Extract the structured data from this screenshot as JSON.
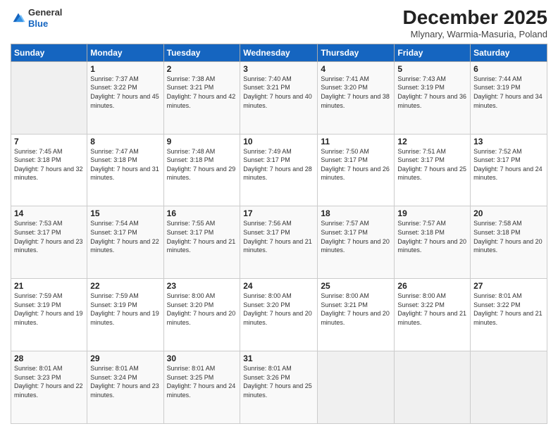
{
  "logo": {
    "general": "General",
    "blue": "Blue"
  },
  "header": {
    "month_title": "December 2025",
    "subtitle": "Mlynary, Warmia-Masuria, Poland"
  },
  "days_of_week": [
    "Sunday",
    "Monday",
    "Tuesday",
    "Wednesday",
    "Thursday",
    "Friday",
    "Saturday"
  ],
  "weeks": [
    [
      {
        "day": "",
        "sunrise": "",
        "sunset": "",
        "daylight": ""
      },
      {
        "day": "1",
        "sunrise": "Sunrise: 7:37 AM",
        "sunset": "Sunset: 3:22 PM",
        "daylight": "Daylight: 7 hours and 45 minutes."
      },
      {
        "day": "2",
        "sunrise": "Sunrise: 7:38 AM",
        "sunset": "Sunset: 3:21 PM",
        "daylight": "Daylight: 7 hours and 42 minutes."
      },
      {
        "day": "3",
        "sunrise": "Sunrise: 7:40 AM",
        "sunset": "Sunset: 3:21 PM",
        "daylight": "Daylight: 7 hours and 40 minutes."
      },
      {
        "day": "4",
        "sunrise": "Sunrise: 7:41 AM",
        "sunset": "Sunset: 3:20 PM",
        "daylight": "Daylight: 7 hours and 38 minutes."
      },
      {
        "day": "5",
        "sunrise": "Sunrise: 7:43 AM",
        "sunset": "Sunset: 3:19 PM",
        "daylight": "Daylight: 7 hours and 36 minutes."
      },
      {
        "day": "6",
        "sunrise": "Sunrise: 7:44 AM",
        "sunset": "Sunset: 3:19 PM",
        "daylight": "Daylight: 7 hours and 34 minutes."
      }
    ],
    [
      {
        "day": "7",
        "sunrise": "Sunrise: 7:45 AM",
        "sunset": "Sunset: 3:18 PM",
        "daylight": "Daylight: 7 hours and 32 minutes."
      },
      {
        "day": "8",
        "sunrise": "Sunrise: 7:47 AM",
        "sunset": "Sunset: 3:18 PM",
        "daylight": "Daylight: 7 hours and 31 minutes."
      },
      {
        "day": "9",
        "sunrise": "Sunrise: 7:48 AM",
        "sunset": "Sunset: 3:18 PM",
        "daylight": "Daylight: 7 hours and 29 minutes."
      },
      {
        "day": "10",
        "sunrise": "Sunrise: 7:49 AM",
        "sunset": "Sunset: 3:17 PM",
        "daylight": "Daylight: 7 hours and 28 minutes."
      },
      {
        "day": "11",
        "sunrise": "Sunrise: 7:50 AM",
        "sunset": "Sunset: 3:17 PM",
        "daylight": "Daylight: 7 hours and 26 minutes."
      },
      {
        "day": "12",
        "sunrise": "Sunrise: 7:51 AM",
        "sunset": "Sunset: 3:17 PM",
        "daylight": "Daylight: 7 hours and 25 minutes."
      },
      {
        "day": "13",
        "sunrise": "Sunrise: 7:52 AM",
        "sunset": "Sunset: 3:17 PM",
        "daylight": "Daylight: 7 hours and 24 minutes."
      }
    ],
    [
      {
        "day": "14",
        "sunrise": "Sunrise: 7:53 AM",
        "sunset": "Sunset: 3:17 PM",
        "daylight": "Daylight: 7 hours and 23 minutes."
      },
      {
        "day": "15",
        "sunrise": "Sunrise: 7:54 AM",
        "sunset": "Sunset: 3:17 PM",
        "daylight": "Daylight: 7 hours and 22 minutes."
      },
      {
        "day": "16",
        "sunrise": "Sunrise: 7:55 AM",
        "sunset": "Sunset: 3:17 PM",
        "daylight": "Daylight: 7 hours and 21 minutes."
      },
      {
        "day": "17",
        "sunrise": "Sunrise: 7:56 AM",
        "sunset": "Sunset: 3:17 PM",
        "daylight": "Daylight: 7 hours and 21 minutes."
      },
      {
        "day": "18",
        "sunrise": "Sunrise: 7:57 AM",
        "sunset": "Sunset: 3:17 PM",
        "daylight": "Daylight: 7 hours and 20 minutes."
      },
      {
        "day": "19",
        "sunrise": "Sunrise: 7:57 AM",
        "sunset": "Sunset: 3:18 PM",
        "daylight": "Daylight: 7 hours and 20 minutes."
      },
      {
        "day": "20",
        "sunrise": "Sunrise: 7:58 AM",
        "sunset": "Sunset: 3:18 PM",
        "daylight": "Daylight: 7 hours and 20 minutes."
      }
    ],
    [
      {
        "day": "21",
        "sunrise": "Sunrise: 7:59 AM",
        "sunset": "Sunset: 3:19 PM",
        "daylight": "Daylight: 7 hours and 19 minutes."
      },
      {
        "day": "22",
        "sunrise": "Sunrise: 7:59 AM",
        "sunset": "Sunset: 3:19 PM",
        "daylight": "Daylight: 7 hours and 19 minutes."
      },
      {
        "day": "23",
        "sunrise": "Sunrise: 8:00 AM",
        "sunset": "Sunset: 3:20 PM",
        "daylight": "Daylight: 7 hours and 20 minutes."
      },
      {
        "day": "24",
        "sunrise": "Sunrise: 8:00 AM",
        "sunset": "Sunset: 3:20 PM",
        "daylight": "Daylight: 7 hours and 20 minutes."
      },
      {
        "day": "25",
        "sunrise": "Sunrise: 8:00 AM",
        "sunset": "Sunset: 3:21 PM",
        "daylight": "Daylight: 7 hours and 20 minutes."
      },
      {
        "day": "26",
        "sunrise": "Sunrise: 8:00 AM",
        "sunset": "Sunset: 3:22 PM",
        "daylight": "Daylight: 7 hours and 21 minutes."
      },
      {
        "day": "27",
        "sunrise": "Sunrise: 8:01 AM",
        "sunset": "Sunset: 3:22 PM",
        "daylight": "Daylight: 7 hours and 21 minutes."
      }
    ],
    [
      {
        "day": "28",
        "sunrise": "Sunrise: 8:01 AM",
        "sunset": "Sunset: 3:23 PM",
        "daylight": "Daylight: 7 hours and 22 minutes."
      },
      {
        "day": "29",
        "sunrise": "Sunrise: 8:01 AM",
        "sunset": "Sunset: 3:24 PM",
        "daylight": "Daylight: 7 hours and 23 minutes."
      },
      {
        "day": "30",
        "sunrise": "Sunrise: 8:01 AM",
        "sunset": "Sunset: 3:25 PM",
        "daylight": "Daylight: 7 hours and 24 minutes."
      },
      {
        "day": "31",
        "sunrise": "Sunrise: 8:01 AM",
        "sunset": "Sunset: 3:26 PM",
        "daylight": "Daylight: 7 hours and 25 minutes."
      },
      {
        "day": "",
        "sunrise": "",
        "sunset": "",
        "daylight": ""
      },
      {
        "day": "",
        "sunrise": "",
        "sunset": "",
        "daylight": ""
      },
      {
        "day": "",
        "sunrise": "",
        "sunset": "",
        "daylight": ""
      }
    ]
  ]
}
